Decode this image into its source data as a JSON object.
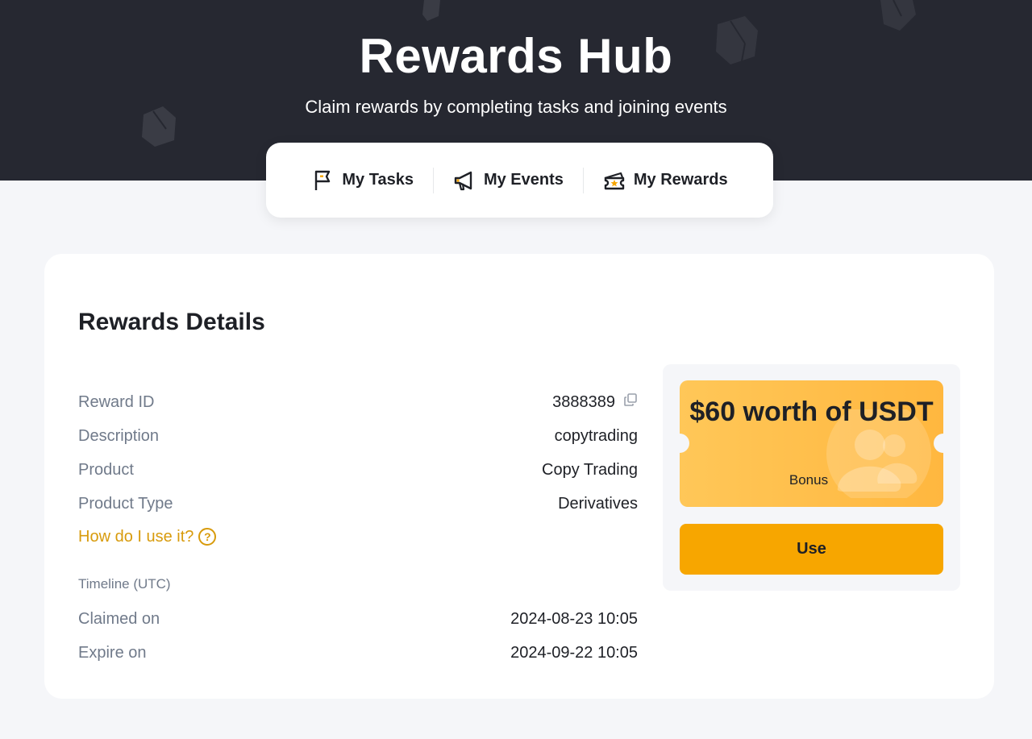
{
  "hero": {
    "title": "Rewards Hub",
    "subtitle": "Claim rewards by completing tasks and joining events"
  },
  "tabs": [
    {
      "label": "My Tasks",
      "icon": "flag-icon"
    },
    {
      "label": "My Events",
      "icon": "megaphone-icon"
    },
    {
      "label": "My Rewards",
      "icon": "ticket-icon"
    }
  ],
  "details": {
    "title": "Rewards Details",
    "rows": [
      {
        "label": "Reward ID",
        "value": "3888389"
      },
      {
        "label": "Description",
        "value": "copytrading"
      },
      {
        "label": "Product",
        "value": "Copy Trading"
      },
      {
        "label": "Product Type",
        "value": "Derivatives"
      }
    ],
    "help_link": "How do I use it?",
    "help_icon": "?",
    "timeline_label": "Timeline (UTC)",
    "timeline": [
      {
        "label": "Claimed on",
        "value": "2024-08-23 10:05"
      },
      {
        "label": "Expire on",
        "value": "2024-09-22 10:05"
      }
    ]
  },
  "voucher": {
    "amount": "$60 worth of USDT",
    "type": "Bonus",
    "button_label": "Use"
  },
  "colors": {
    "hero_bg": "#262831",
    "accent": "#f7a600",
    "link": "#d89b0c",
    "voucher_gradient_start": "#ffc758",
    "voucher_gradient_end": "#ffb73f"
  }
}
